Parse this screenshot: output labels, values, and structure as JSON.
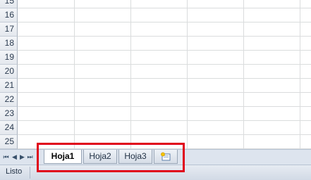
{
  "rows": [
    "15",
    "16",
    "17",
    "18",
    "19",
    "20",
    "21",
    "22",
    "23",
    "24",
    "25"
  ],
  "nav_buttons": {
    "first": "⏮",
    "prev": "◀",
    "next": "▶",
    "last": "⏭"
  },
  "tabs": [
    {
      "label": "Hoja1",
      "active": true
    },
    {
      "label": "Hoja2",
      "active": false
    },
    {
      "label": "Hoja3",
      "active": false
    }
  ],
  "status": {
    "text": "Listo"
  },
  "colors": {
    "highlight": "#e0001b",
    "bar": "#dde4ee"
  }
}
